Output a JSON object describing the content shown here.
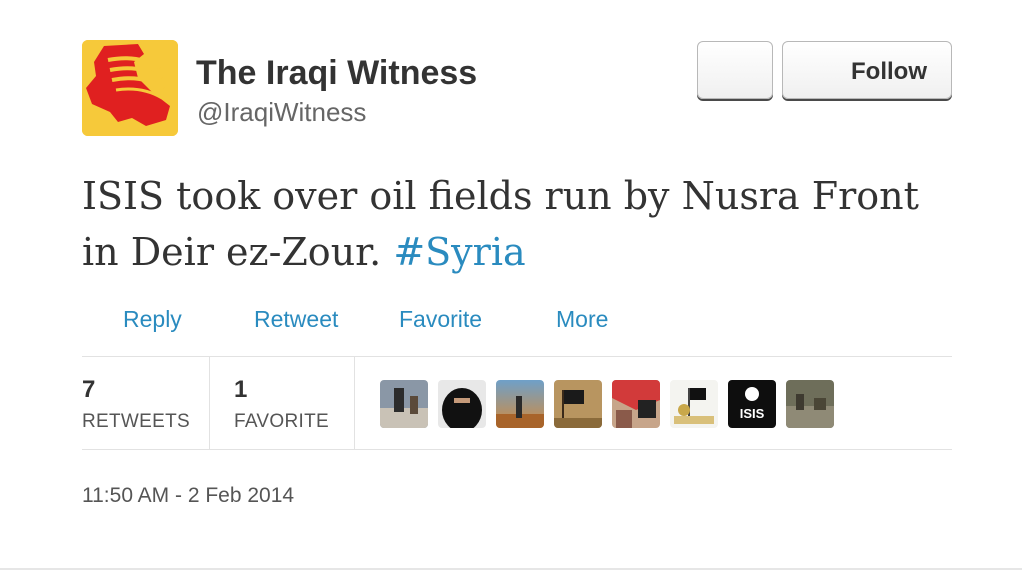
{
  "user": {
    "name": "The Iraqi Witness",
    "handle": "@IraqiWitness"
  },
  "buttons": {
    "follow_label": "Follow"
  },
  "tweet": {
    "text_main": "ISIS took over oil fields run by Nusra Front in Deir ez-Zour. ",
    "hashtag": "#Syria"
  },
  "actions": [
    {
      "label": "Reply"
    },
    {
      "label": "Retweet"
    },
    {
      "label": "Favorite"
    },
    {
      "label": "More"
    }
  ],
  "stats": {
    "retweets_count": "7",
    "retweets_label": "RETWEETS",
    "favorites_count": "1",
    "favorites_label": "FAVORITE"
  },
  "favoriters_icon_names": [
    "stairs-photo-avatar",
    "veiled-woman-avatar",
    "desert-soldier-avatar",
    "flag-avatar",
    "keffiyeh-avatar",
    "flag-drawing-avatar",
    "isis-logo-avatar",
    "ruins-avatar"
  ],
  "isis_avatar_text": "ISIS",
  "timestamp": "11:50 AM - 2 Feb 2014",
  "colors": {
    "link": "#2a8bbf",
    "avatar_bg": "#f6c93a",
    "map_red": "#e02020"
  }
}
